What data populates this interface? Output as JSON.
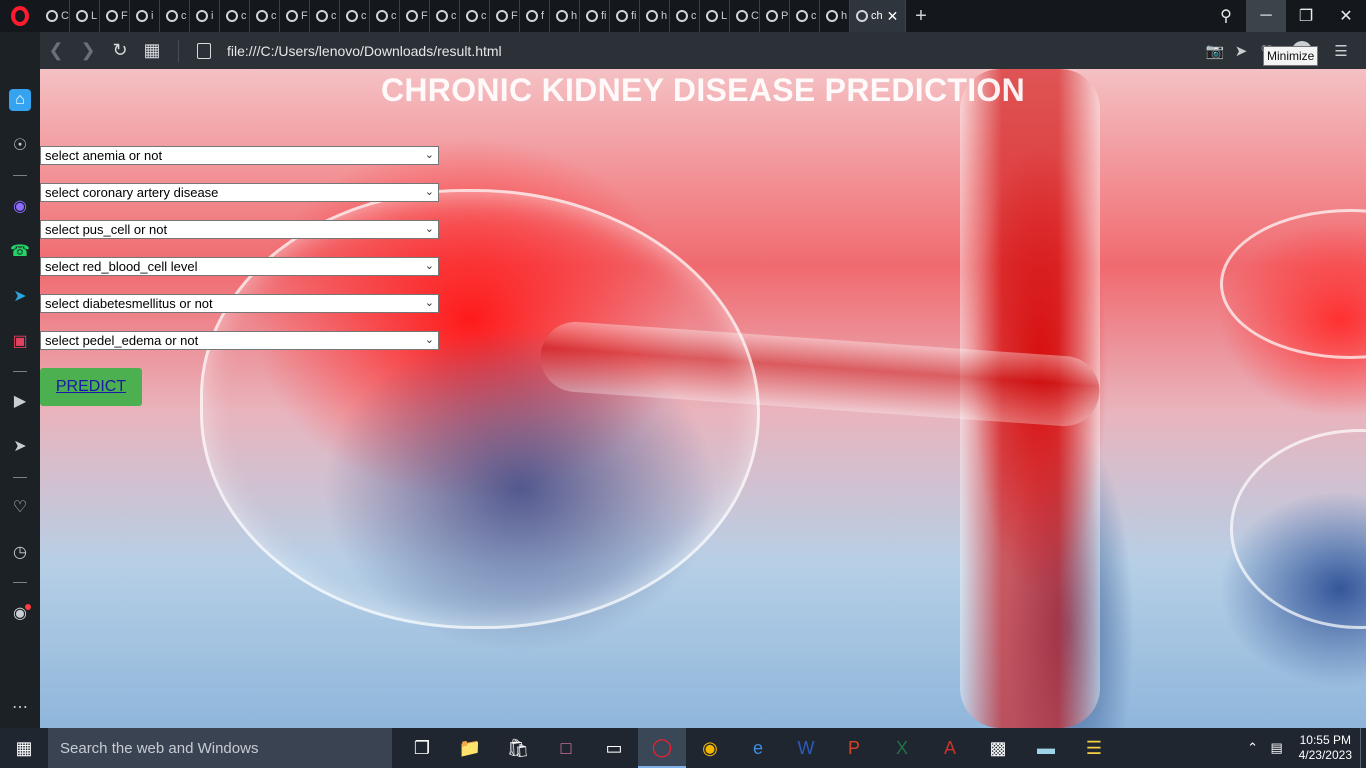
{
  "browser": {
    "tabs": [
      {
        "label": "C"
      },
      {
        "label": "L"
      },
      {
        "label": "F"
      },
      {
        "label": "i"
      },
      {
        "label": "c"
      },
      {
        "label": "i"
      },
      {
        "label": "c"
      },
      {
        "label": "c"
      },
      {
        "label": "F"
      },
      {
        "label": "c"
      },
      {
        "label": "c"
      },
      {
        "label": "c"
      },
      {
        "label": "F"
      },
      {
        "label": "c"
      },
      {
        "label": "c"
      },
      {
        "label": "F"
      },
      {
        "label": "f"
      },
      {
        "label": "h"
      },
      {
        "label": "fi"
      },
      {
        "label": "fi"
      },
      {
        "label": "h"
      },
      {
        "label": "c"
      },
      {
        "label": "L"
      },
      {
        "label": "C"
      },
      {
        "label": "P"
      },
      {
        "label": "c"
      },
      {
        "label": "h"
      }
    ],
    "active_tab": {
      "label": "ch"
    },
    "url": "file:///C:/Users/lenovo/Downloads/result.html",
    "tooltip": "Minimize"
  },
  "page": {
    "title": "CHRONIC KIDNEY DISEASE PREDICTION",
    "selects": [
      {
        "value": "select anemia or not"
      },
      {
        "value": "select coronary artery disease"
      },
      {
        "value": "select pus_cell or not"
      },
      {
        "value": "select red_blood_cell level"
      },
      {
        "value": "select diabetesmellitus or not"
      },
      {
        "value": "select pedel_edema or not"
      }
    ],
    "predict_label": "PREDICT"
  },
  "taskbar": {
    "search_placeholder": "Search the web and Windows",
    "time": "10:55 PM",
    "date": "4/23/2023"
  },
  "colors": {
    "opera_red": "#ff1b2d",
    "predict_button": "#4caf50",
    "home_accent": "#35a3f0"
  }
}
